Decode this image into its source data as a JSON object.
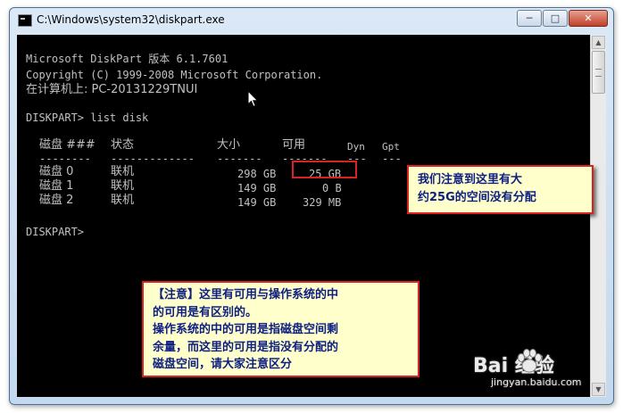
{
  "window": {
    "title": "C:\\Windows\\system32\\diskpart.exe",
    "buttons": {
      "minimize": "─",
      "maximize": "□",
      "close": "✕"
    }
  },
  "console": {
    "line1": "Microsoft DiskPart 版本 6.1.7601",
    "line2": "Copyright (C) 1999-2008 Microsoft Corporation.",
    "line3": "在计算机上: PC-20131229TNUI",
    "prompt1": "DISKPART> list disk",
    "headers": {
      "disk": "磁盘 ###",
      "status": "状态",
      "size": "大小",
      "free": "可用",
      "dyn": "Dyn",
      "gpt": "Gpt"
    },
    "dashes": {
      "disk": "--------",
      "status": "-------------",
      "size": "-------",
      "free": "-------",
      "dyn": "---",
      "gpt": "---"
    },
    "rows": [
      {
        "disk": "磁盘 0",
        "status": "联机",
        "size": "298 GB",
        "free": "25 GB"
      },
      {
        "disk": "磁盘 1",
        "status": "联机",
        "size": "149 GB",
        "free": "0 B"
      },
      {
        "disk": "磁盘 2",
        "status": "联机",
        "size": "149 GB",
        "free": "329 MB"
      }
    ],
    "prompt2": "DISKPART>"
  },
  "annotations": {
    "note1": [
      "我们注意到这里有大",
      "约25G的空间没有分配"
    ],
    "note2": [
      "【注意】这里有可用与操作系统的中",
      "的可用是有区别的。",
      "操作系统的中的可用是指磁盘空间剩",
      "余量，而这里的可用是指没有分配的",
      "磁盘空间，请大家注意区分"
    ]
  },
  "watermark": {
    "brand": "Bai 经验",
    "url": "jingyan.baidu.com"
  },
  "colors": {
    "highlight": "#d92323",
    "note_text": "#0d1f80",
    "note_bg": "#ffffcc",
    "console_text": "#c0c0c0"
  }
}
